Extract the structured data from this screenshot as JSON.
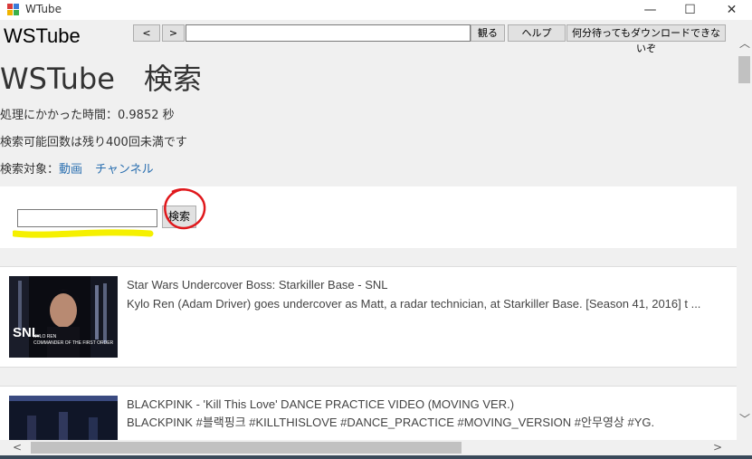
{
  "window": {
    "title": "WTube",
    "minimize": "—",
    "maximize": "☐",
    "close": "✕"
  },
  "toolbar": {
    "logo": "WSTube",
    "back": "<",
    "forward": ">",
    "url_value": "",
    "watch": "観る",
    "help": "ヘルプ",
    "no_download": "何分待ってもダウンロードできないぞ"
  },
  "page": {
    "heading": "WSTube　検索",
    "time_taken": "処理にかかった時間：0.9852 秒",
    "remaining": "検索可能回数は残り400回未満です",
    "target_label": "検索対象：",
    "target_video": "動画",
    "target_channel": "チャンネル"
  },
  "search": {
    "value": "",
    "button": "検索"
  },
  "results": [
    {
      "title": "Star Wars Undercover Boss: Starkiller Base - SNL",
      "desc": "Kylo Ren (Adam Driver) goes undercover as Matt, a radar technician, at Starkiller Base. [Season 41, 2016] t ...",
      "thumb_label": "SNL",
      "thumb_caption": "KYLO REN",
      "thumb_subcaption": "COMMANDER OF THE FIRST ORDER"
    },
    {
      "title": "BLACKPINK - 'Kill This Love' DANCE PRACTICE VIDEO (MOVING VER.)",
      "desc": "BLACKPINK #블랙핑크 #KILLTHISLOVE #DANCE_PRACTICE #MOVING_VERSION #안무영상 #YG."
    }
  ],
  "scrollbars": {
    "up": "︿",
    "down": "﹀",
    "left": "<",
    "right": ">"
  },
  "colors": {
    "highlight": "#ffff00",
    "annotation_circle": "#e0181c",
    "link": "#2a6fb0"
  }
}
